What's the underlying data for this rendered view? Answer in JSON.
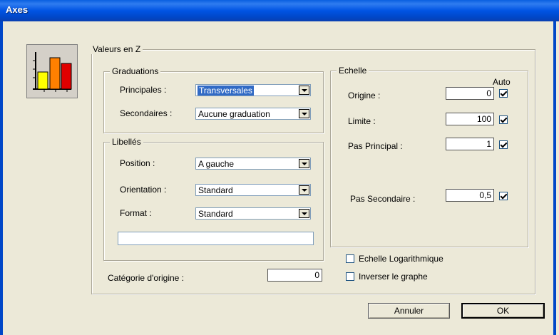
{
  "window": {
    "title": "Axes"
  },
  "groups": {
    "valeurs": "Valeurs en Z",
    "graduations": "Graduations",
    "libelles": "Libellés",
    "echelle": "Echelle"
  },
  "graduations": {
    "principales_label": "Principales :",
    "principales_value": "Transversales",
    "secondaires_label": "Secondaires :",
    "secondaires_value": "Aucune graduation"
  },
  "libelles": {
    "position_label": "Position :",
    "position_value": "A gauche",
    "orientation_label": "Orientation :",
    "orientation_value": "Standard",
    "format_label": "Format :",
    "format_value": "Standard",
    "format_text": ""
  },
  "categorie": {
    "label": "Catégorie d'origine :",
    "value": "0"
  },
  "echelle": {
    "auto_label": "Auto",
    "origine_label": "Origine :",
    "origine_value": "0",
    "origine_auto": true,
    "limite_label": "Limite :",
    "limite_value": "100",
    "limite_auto": true,
    "pas_principal_label": "Pas Principal :",
    "pas_principal_value": "1",
    "pas_principal_auto": true,
    "pas_secondaire_label": "Pas Secondaire :",
    "pas_secondaire_value": "0,5",
    "pas_secondaire_auto": true
  },
  "options": {
    "log_label": "Echelle Logarithmique",
    "log_checked": false,
    "inverser_label": "Inverser le graphe",
    "inverser_checked": false
  },
  "buttons": {
    "annuler": "Annuler",
    "ok": "OK"
  },
  "icon": {
    "name": "bar-chart-icon",
    "colors": [
      "#ffff00",
      "#ff8000",
      "#e00000"
    ]
  }
}
